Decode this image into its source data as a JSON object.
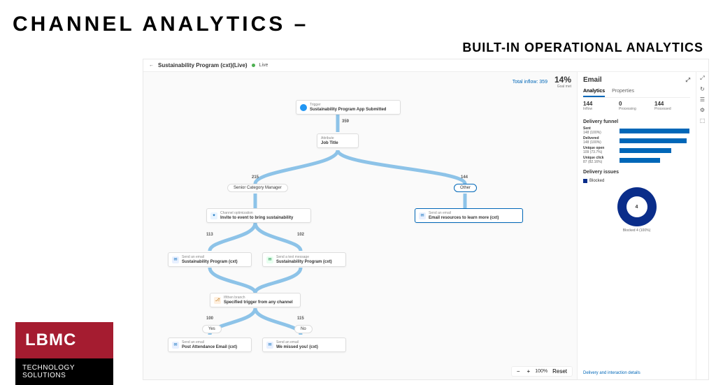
{
  "slide": {
    "title": "CHANNEL  ANALYTICS –",
    "subtitle": "BUILT-IN OPERATIONAL ANALYTICS"
  },
  "lbmc": {
    "brand": "LBMC",
    "unit1": "TECHNOLOGY",
    "unit2": "SOLUTIONS"
  },
  "header": {
    "journey_name": "Sustainability Program (cxt)(Live)",
    "status": "Live"
  },
  "top_stats": {
    "inflow_label": "Total inflow: 359",
    "goal_pct": "14%",
    "goal_sub": "Goal met"
  },
  "zoom": {
    "level": "100%",
    "reset": "Reset"
  },
  "flow": {
    "trigger": {
      "type": "Trigger",
      "label": "Sustainability Program App Submitted",
      "out": "359"
    },
    "attribute": {
      "type": "Attribute",
      "label": "Job Title"
    },
    "branch_left": {
      "count": "215",
      "label": "Senior Category Manager"
    },
    "branch_right": {
      "count": "144",
      "label": "Other"
    },
    "opt": {
      "type": "Channel optimization",
      "label": "Invite to event to bring sustainability"
    },
    "email_right": {
      "type": "Send an email",
      "label": "Email resources to learn more (cxt)"
    },
    "split_left": "113",
    "split_right": "102",
    "email_a": {
      "type": "Send an email",
      "label": "Sustainability Program (cxt)"
    },
    "sms_a": {
      "type": "Send a text message",
      "label": "Sustainability Program (cxt)"
    },
    "ifthen": {
      "type": "If/then branch",
      "label": "Specified trigger from any channel"
    },
    "yes_count": "100",
    "no_count": "115",
    "yes_label": "Yes",
    "no_label": "No",
    "email_yes": {
      "type": "Send an email",
      "label": "Post Attendance Email (cxt)"
    },
    "email_no": {
      "type": "Send an email",
      "label": "We missed you! (cxt)"
    }
  },
  "panel": {
    "title": "Email",
    "tabs": {
      "analytics": "Analytics",
      "properties": "Properties"
    },
    "stats": [
      {
        "num": "144",
        "lbl": "Inflow"
      },
      {
        "num": "0",
        "lbl": "Processing"
      },
      {
        "num": "144",
        "lbl": "Processed"
      }
    ],
    "funnel_title": "Delivery funnel",
    "funnel": [
      {
        "name": "Sent",
        "value": "148 (100%)",
        "pct": 100
      },
      {
        "name": "Delivered",
        "value": "148 (100%)",
        "pct": 96
      },
      {
        "name": "Unique open",
        "value": "109 (73.7%)",
        "pct": 74
      },
      {
        "name": "Unique click",
        "value": "87 (82.16%)",
        "pct": 58
      }
    ],
    "issues_title": "Delivery issues",
    "issues_legend": "Blocked",
    "donut_center": "4",
    "donut_caption": "Blocked\n4 (100%)",
    "details_link": "Delivery and interaction details"
  }
}
